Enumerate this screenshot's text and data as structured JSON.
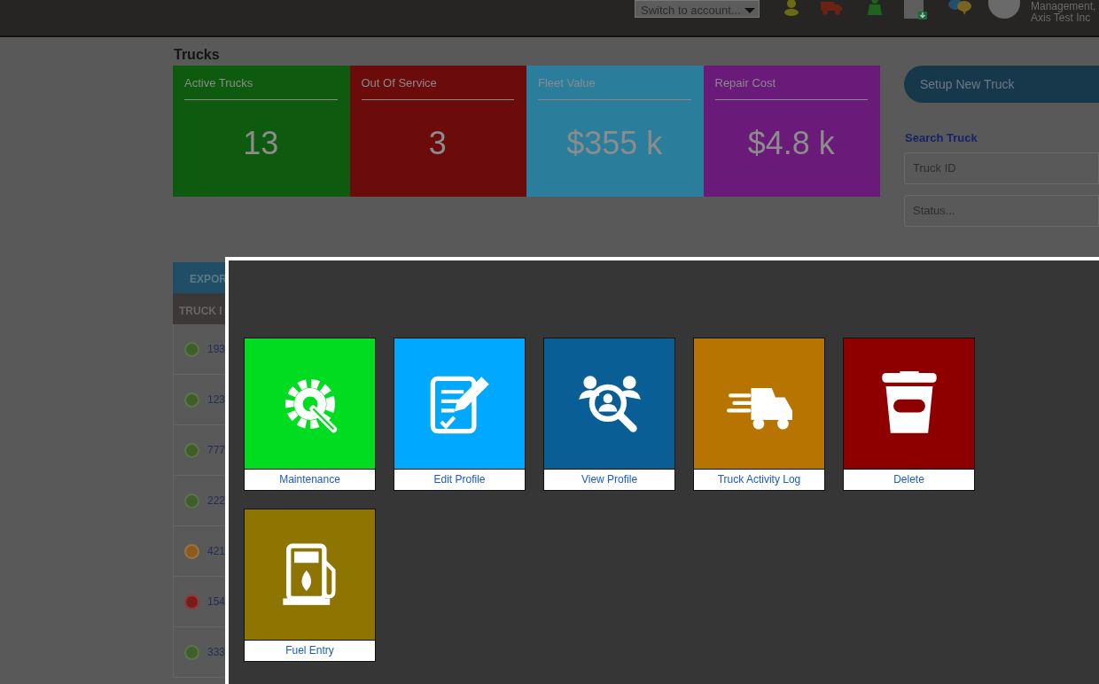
{
  "top_bar": {
    "account_select": {
      "placeholder": "Switch to account..."
    },
    "user": {
      "line_1": "Management,",
      "line_2": "Axis Test Inc"
    }
  },
  "page_title": "Trucks",
  "stats": [
    {
      "label": "Active Trucks",
      "value": "13",
      "color": "#0e5a0e"
    },
    {
      "label": "Out Of Service",
      "value": "3",
      "color": "#6c0b0c"
    },
    {
      "label": "Fleet Value",
      "value": "$355 k",
      "color": "#2b7e9b"
    },
    {
      "label": "Repair Cost",
      "value": "$4.8 k",
      "color": "#6a1a78"
    }
  ],
  "setup_button": "Setup New Truck",
  "search": {
    "title": "Search Truck",
    "fields": [
      {
        "placeholder": "Truck ID"
      },
      {
        "placeholder": "Status..."
      }
    ]
  },
  "table": {
    "export_button": "EXPOR",
    "columns": [
      "TRUCK I"
    ],
    "rows": [
      {
        "color": "#3e5e2a",
        "truck_id": "193"
      },
      {
        "color": "#3e5e2a",
        "truck_id": "123"
      },
      {
        "color": "#3e5e2a",
        "truck_id": "777"
      },
      {
        "color": "#3e5e2a",
        "truck_id": "222"
      },
      {
        "color": "#8a5a20",
        "truck_id": "421"
      },
      {
        "color": "#7a1a1a",
        "truck_id": "154"
      },
      {
        "color": "#3e5e2a",
        "truck_id": "333"
      }
    ]
  },
  "action_menu": {
    "tiles": [
      {
        "kind": "maintenance",
        "label": "Maintenance",
        "color": "#00dd20"
      },
      {
        "kind": "edit",
        "label": "Edit Profile",
        "color": "#00a8ff"
      },
      {
        "kind": "view",
        "label": "View Profile",
        "color": "#0a5e96"
      },
      {
        "kind": "activity",
        "label": "Truck Activity Log",
        "color": "#b87400"
      },
      {
        "kind": "delete",
        "label": "Delete",
        "color": "#8e0000"
      },
      {
        "kind": "fuel",
        "label": "Fuel Entry",
        "color": "#8e7400"
      }
    ]
  }
}
